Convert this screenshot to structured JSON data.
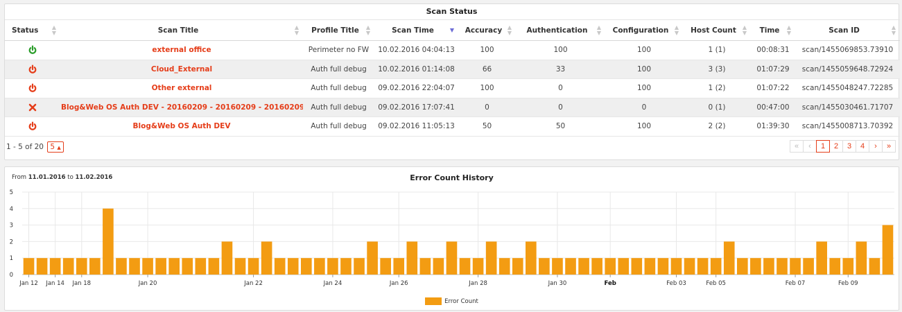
{
  "status_panel": {
    "title": "Scan Status",
    "columns": [
      "Status",
      "Scan Title",
      "Profile Title",
      "Scan Time",
      "Accuracy",
      "Authentication",
      "Configuration",
      "Host Count",
      "Time",
      "Scan ID"
    ],
    "rows": [
      {
        "status": "running",
        "status_icon": "power-icon",
        "status_color": "#2a9d2a",
        "title": "external office",
        "profile": "Perimeter no FW",
        "scan_time": "10.02.2016 04:04:13",
        "accuracy": "100",
        "authentication": "100",
        "configuration": "100",
        "host_count": "1 (1)",
        "time": "00:08:31",
        "scan_id": "scan/1455069853.73910"
      },
      {
        "status": "stopped",
        "status_icon": "power-icon",
        "status_color": "#e53d19",
        "title": "Cloud_External",
        "profile": "Auth full debug",
        "scan_time": "10.02.2016 01:14:08",
        "accuracy": "66",
        "authentication": "33",
        "configuration": "100",
        "host_count": "3 (3)",
        "time": "01:07:29",
        "scan_id": "scan/1455059648.72924"
      },
      {
        "status": "stopped",
        "status_icon": "power-icon",
        "status_color": "#e53d19",
        "title": "Other external",
        "profile": "Auth full debug",
        "scan_time": "09.02.2016 22:04:07",
        "accuracy": "100",
        "authentication": "0",
        "configuration": "100",
        "host_count": "1 (2)",
        "time": "01:07:22",
        "scan_id": "scan/1455048247.72285"
      },
      {
        "status": "failed",
        "status_icon": "x-icon",
        "status_color": "#e53d19",
        "title": "Blog&Web OS Auth DEV - 20160209 - 20160209 - 20160209",
        "profile": "Auth full debug",
        "scan_time": "09.02.2016 17:07:41",
        "accuracy": "0",
        "authentication": "0",
        "configuration": "0",
        "host_count": "0 (1)",
        "time": "00:47:00",
        "scan_id": "scan/1455030461.71707"
      },
      {
        "status": "stopped",
        "status_icon": "power-icon",
        "status_color": "#e53d19",
        "title": "Blog&Web OS Auth DEV",
        "profile": "Auth full debug",
        "scan_time": "09.02.2016 11:05:13",
        "accuracy": "50",
        "authentication": "50",
        "configuration": "100",
        "host_count": "2 (2)",
        "time": "01:39:30",
        "scan_id": "scan/1455008713.70392"
      }
    ],
    "pagination": {
      "summary": "1 - 5 of 20",
      "page_size": "5",
      "first": "«",
      "prev": "‹",
      "pages": [
        "1",
        "2",
        "3",
        "4"
      ],
      "current": "1",
      "next": "›",
      "last": "»"
    }
  },
  "chart_panel": {
    "date_prefix": "From",
    "date_from": "11.01.2016",
    "date_middle": "to",
    "date_to": "11.02.2016",
    "colors": {
      "bar": "#f39c12",
      "grid": "#e8e8e8"
    }
  },
  "chart_data": {
    "type": "bar",
    "title": "Error Count History",
    "xlabel": "",
    "ylabel": "",
    "ylim": [
      0,
      5
    ],
    "yticks": [
      0,
      1,
      2,
      3,
      4,
      5
    ],
    "grid": true,
    "legend": "bottom-center",
    "series": [
      {
        "name": "Error Count",
        "values": [
          1,
          1,
          1,
          1,
          1,
          1,
          4,
          1,
          1,
          1,
          1,
          1,
          1,
          1,
          1,
          2,
          1,
          1,
          2,
          1,
          1,
          1,
          1,
          1,
          1,
          1,
          2,
          1,
          1,
          2,
          1,
          1,
          2,
          1,
          1,
          2,
          1,
          1,
          2,
          1,
          1,
          1,
          1,
          1,
          1,
          1,
          1,
          1,
          1,
          1,
          1,
          1,
          1,
          2,
          1,
          1,
          1,
          1,
          1,
          1,
          2,
          1,
          1,
          2,
          1,
          3
        ]
      }
    ],
    "xticks": [
      {
        "label": "Jan 12",
        "index": 0.5,
        "bold": false
      },
      {
        "label": "Jan 14",
        "index": 2.5,
        "bold": false
      },
      {
        "label": "Jan 18",
        "index": 4.5,
        "bold": false
      },
      {
        "label": "Jan 20",
        "index": 9.5,
        "bold": false
      },
      {
        "label": "Jan 22",
        "index": 17.5,
        "bold": false
      },
      {
        "label": "Jan 24",
        "index": 23.5,
        "bold": false
      },
      {
        "label": "Jan 26",
        "index": 28.5,
        "bold": false
      },
      {
        "label": "Jan 28",
        "index": 34.5,
        "bold": false
      },
      {
        "label": "Jan 30",
        "index": 40.5,
        "bold": false
      },
      {
        "label": "Feb",
        "index": 44.5,
        "bold": true
      },
      {
        "label": "Feb 03",
        "index": 49.5,
        "bold": false
      },
      {
        "label": "Feb 05",
        "index": 52.5,
        "bold": false
      },
      {
        "label": "Feb 07",
        "index": 58.5,
        "bold": false
      },
      {
        "label": "Feb 09",
        "index": 62.5,
        "bold": false
      }
    ]
  }
}
